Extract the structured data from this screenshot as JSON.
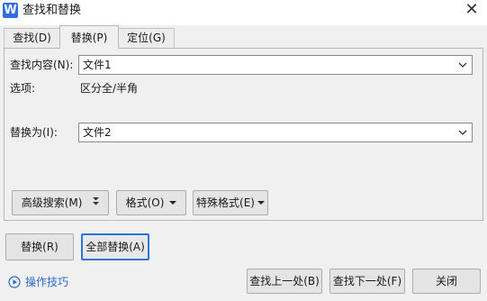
{
  "window": {
    "app_icon_letter": "W",
    "title": "查找和替换",
    "close_glyph": "✕"
  },
  "tabs": [
    {
      "label": "查找(D)",
      "active": false
    },
    {
      "label": "替换(P)",
      "active": true
    },
    {
      "label": "定位(G)",
      "active": false
    }
  ],
  "find": {
    "label": "查找内容(N):",
    "value": "文件1"
  },
  "options": {
    "label": "选项:",
    "value": "区分全/半角"
  },
  "replace": {
    "label": "替换为(I):",
    "value": "文件2"
  },
  "search_buttons": {
    "advanced": "高级搜索(M)",
    "format": "格式(O)",
    "special": "特殊格式(E)"
  },
  "action_buttons": {
    "replace": "替换(R)",
    "replace_all": "全部替换(A)"
  },
  "footer": {
    "tips_link": "操作技巧",
    "find_prev": "查找上一处(B)",
    "find_next": "查找下一处(F)",
    "close": "关闭"
  },
  "colors": {
    "accent": "#2f74d0",
    "link": "#2b6bc7",
    "app_icon": "#2f6fe0"
  },
  "icons": {
    "app": "wps-writer-icon",
    "close": "close-icon",
    "dropdown": "chevron-down-icon",
    "expand": "double-chevron-down-icon",
    "menu": "caret-down-icon",
    "tips": "play-circle-icon"
  }
}
